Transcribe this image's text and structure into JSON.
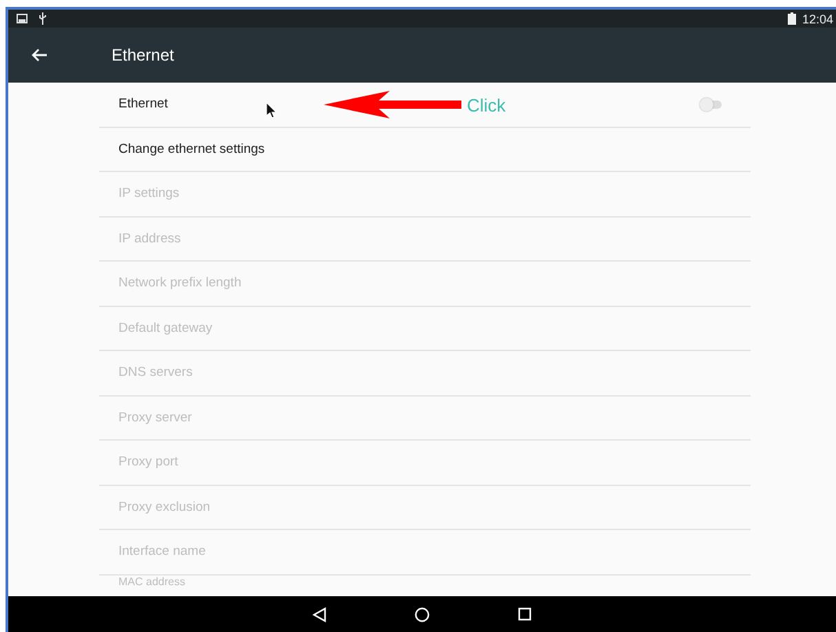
{
  "status_bar": {
    "time": "12:04"
  },
  "app_bar": {
    "title": "Ethernet"
  },
  "settings": [
    {
      "label": "Ethernet",
      "enabled": true,
      "kind": "toggle",
      "on": false
    },
    {
      "label": "Change ethernet settings",
      "enabled": true,
      "kind": "plain"
    },
    {
      "label": "IP settings",
      "enabled": false,
      "kind": "plain"
    },
    {
      "label": "IP address",
      "enabled": false,
      "kind": "plain"
    },
    {
      "label": "Network prefix length",
      "enabled": false,
      "kind": "plain"
    },
    {
      "label": "Default gateway",
      "enabled": false,
      "kind": "plain"
    },
    {
      "label": "DNS servers",
      "enabled": false,
      "kind": "plain"
    },
    {
      "label": "Proxy server",
      "enabled": false,
      "kind": "plain"
    },
    {
      "label": "Proxy port",
      "enabled": false,
      "kind": "plain"
    },
    {
      "label": "Proxy exclusion",
      "enabled": false,
      "kind": "plain"
    },
    {
      "label": "Interface name",
      "enabled": false,
      "kind": "plain"
    },
    {
      "label": "MAC address",
      "enabled": false,
      "kind": "plain"
    }
  ],
  "annotation": {
    "text": "Click"
  }
}
